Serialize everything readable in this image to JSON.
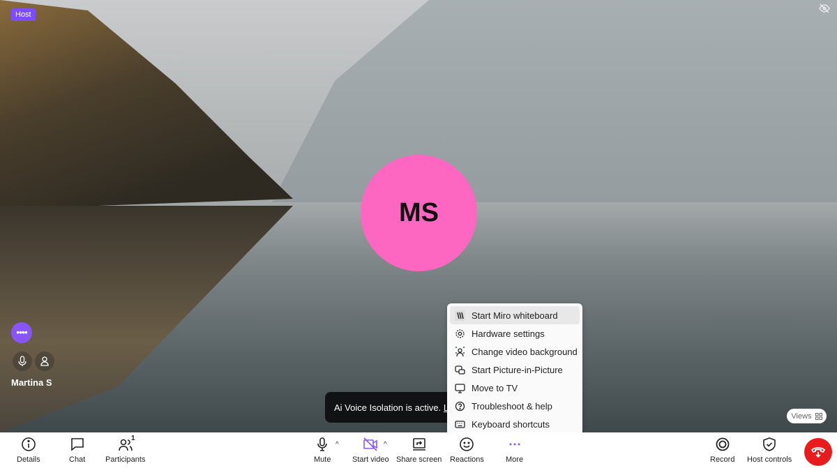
{
  "stage": {
    "host_badge": "Host",
    "avatar_initials": "MS",
    "avatar_color": "#fe67c1",
    "participant_name": "Martina S",
    "views_label": "Views"
  },
  "toast": {
    "text": "Ai Voice Isolation is active. ",
    "link": "L"
  },
  "more_menu": {
    "items": [
      {
        "label": "Start Miro whiteboard",
        "icon": "miro-icon"
      },
      {
        "label": "Hardware settings",
        "icon": "gear-icon"
      },
      {
        "label": "Change video background",
        "icon": "background-icon"
      },
      {
        "label": "Start Picture-in-Picture",
        "icon": "pip-icon"
      },
      {
        "label": "Move to TV",
        "icon": "monitor-icon"
      },
      {
        "label": "Troubleshoot & help",
        "icon": "help-icon"
      },
      {
        "label": "Keyboard shortcuts",
        "icon": "keyboard-icon"
      }
    ]
  },
  "toolbar": {
    "details": "Details",
    "chat": "Chat",
    "participants": "Participants",
    "participants_count": "1",
    "mute": "Mute",
    "start_video": "Start video",
    "share_screen": "Share screen",
    "reactions": "Reactions",
    "more": "More",
    "record": "Record",
    "host_controls": "Host controls"
  },
  "colors": {
    "accent": "#8a55f7",
    "end_call": "#e81c1c"
  }
}
